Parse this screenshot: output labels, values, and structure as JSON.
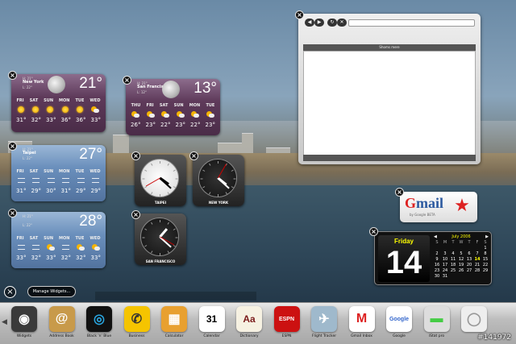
{
  "weather": [
    {
      "hilo": "H: 21°",
      "city": "New York",
      "low": "L: 22°",
      "temp": "21°",
      "days": [
        "FRI",
        "SAT",
        "SUN",
        "MON",
        "TUE",
        "WED"
      ],
      "icons": [
        "sun-icon",
        "sun-icon",
        "sun-icon",
        "sun-icon",
        "sun-icon",
        "sun-cloud-icon"
      ],
      "temps": [
        "31°",
        "32°",
        "33°",
        "36°",
        "36°",
        "33°"
      ]
    },
    {
      "hilo": "H: 21°",
      "city": "San Francisco",
      "low": "L: 12°",
      "temp": "13°",
      "days": [
        "THU",
        "FRI",
        "SAT",
        "SUN",
        "MON",
        "TUE"
      ],
      "icons": [
        "sun-cloud-icon",
        "sun-cloud-icon",
        "sun-cloud-icon",
        "sun-cloud-icon",
        "sun-cloud-icon",
        "sun-cloud-icon"
      ],
      "temps": [
        "26°",
        "23°",
        "22°",
        "23°",
        "22°",
        "23°"
      ]
    },
    {
      "hilo": "H: 21°",
      "city": "Taipei",
      "low": "L: 22°",
      "temp": "27°",
      "days": [
        "FRI",
        "SAT",
        "SUN",
        "MON",
        "TUE",
        "WED"
      ],
      "icons": [
        "wind-icon",
        "wind-icon",
        "wind-icon",
        "wind-icon",
        "wind-icon",
        "wind-icon"
      ],
      "temps": [
        "31°",
        "29°",
        "30°",
        "31°",
        "29°",
        "29°"
      ]
    },
    {
      "hilo": "H: 21°",
      "city": "",
      "low": "L: 22°",
      "temp": "28°",
      "days": [
        "FRI",
        "SAT",
        "SUN",
        "MON",
        "TUE",
        "WED"
      ],
      "icons": [
        "wind-icon",
        "wind-icon",
        "sun-cloud-icon",
        "wind-icon",
        "sun-cloud-icon",
        "sun-cloud-icon"
      ],
      "temps": [
        "33°",
        "32°",
        "33°",
        "32°",
        "32°",
        "33°"
      ]
    }
  ],
  "clocks": [
    {
      "label": "TAIPEI",
      "hour": 4.2,
      "minute": 22,
      "second": 40
    },
    {
      "label": "NEW YORK",
      "hour": 4.3,
      "minute": 22,
      "second": 5
    },
    {
      "label": "SAN FRANCISCO",
      "hour": 1.35,
      "minute": 22,
      "second": 20
    }
  ],
  "browser": {
    "tab_title": "Shoms mere"
  },
  "gmail": {
    "logo": "Gmail",
    "sub": "by Google",
    "beta": "BETA"
  },
  "calendar": {
    "day_name": "Friday",
    "day_num": "14",
    "month": "July 2006",
    "weekdays": [
      "S",
      "M",
      "T",
      "W",
      "T",
      "F",
      "S"
    ],
    "cells": [
      "",
      "",
      "",
      "",
      "",
      "",
      "1",
      "2",
      "3",
      "4",
      "5",
      "6",
      "7",
      "8",
      "9",
      "10",
      "11",
      "12",
      "13",
      "14",
      "15",
      "16",
      "17",
      "18",
      "19",
      "20",
      "21",
      "22",
      "23",
      "24",
      "25",
      "26",
      "27",
      "28",
      "29",
      "30",
      "31"
    ],
    "today": "14"
  },
  "manage": {
    "label": "Manage Widgets..."
  },
  "widget_bar": [
    {
      "label": "Widgets",
      "icon": "widgets-icon",
      "bg": "#3a3a3a",
      "fg": "#fff",
      "glyph": "◉"
    },
    {
      "label": "Address Book",
      "icon": "address-book-icon",
      "bg": "#c89a4a",
      "fg": "#fff",
      "glyph": "@"
    },
    {
      "label": "Black 'n' Blue",
      "icon": "black-n-blue-icon",
      "bg": "#111",
      "fg": "#29a6e0",
      "glyph": "◎"
    },
    {
      "label": "Business",
      "icon": "business-icon",
      "bg": "#f5c400",
      "fg": "#333",
      "glyph": "✆"
    },
    {
      "label": "Calculator",
      "icon": "calculator-icon",
      "bg": "#e8a030",
      "fg": "#fff",
      "glyph": "▦"
    },
    {
      "label": "Calendar",
      "icon": "calendar-icon",
      "bg": "#fff",
      "fg": "#000",
      "glyph": "31"
    },
    {
      "label": "Dictionary",
      "icon": "dictionary-icon",
      "bg": "#f6f1e2",
      "fg": "#7a1a1a",
      "glyph": "Aa"
    },
    {
      "label": "ESPN",
      "icon": "espn-icon",
      "bg": "#cc1111",
      "fg": "#fff",
      "glyph": "ESPN"
    },
    {
      "label": "Flight Tracker",
      "icon": "flight-tracker-icon",
      "bg": "#9fb9cc",
      "fg": "#fff",
      "glyph": "✈"
    },
    {
      "label": "Gmail Inbox",
      "icon": "gmail-inbox-icon",
      "bg": "#fff",
      "fg": "#d22",
      "glyph": "M"
    },
    {
      "label": "Google",
      "icon": "google-icon",
      "bg": "#fff",
      "fg": "#3366cc",
      "glyph": "Google"
    },
    {
      "label": "iStat pro",
      "icon": "istat-pro-icon",
      "bg": "#ddd",
      "fg": "#4c4",
      "glyph": "▬"
    },
    {
      "label": "",
      "icon": "disc-icon",
      "bg": "#eee",
      "fg": "#999",
      "glyph": "◯"
    }
  ],
  "watermark": "#141972"
}
